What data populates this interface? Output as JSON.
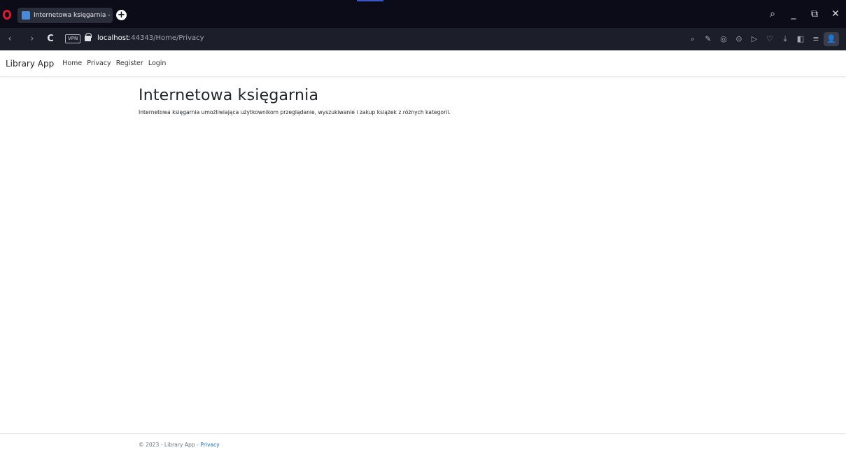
{
  "browser": {
    "tab_title": "Internetowa księgarnia - L",
    "new_tab_symbol": "+",
    "url_host": "localhost",
    "url_path": ":44343/Home/Privacy",
    "vpn_label": "VPN",
    "nav_icons": {
      "back": "‹",
      "forward": "›",
      "reload": "C"
    },
    "window_controls": {
      "search": "⌕",
      "minimize": "_",
      "restore": "⧉",
      "close": "✕"
    },
    "extension_icons": [
      "⌕",
      "✎",
      "◎",
      "⊙",
      "▷",
      "♡",
      "⤓",
      "◧",
      "≡",
      "👤"
    ]
  },
  "navbar": {
    "brand": "Library App",
    "links": [
      "Home",
      "Privacy",
      "Register",
      "Login"
    ]
  },
  "main": {
    "heading": "Internetowa księgarnia",
    "description": "Internetowa księgarnia umożliwiająca użytkownikom przeglądanie, wyszukiwanie i zakup książek z różnych kategorii."
  },
  "footer": {
    "text": "© 2023 - Library App - ",
    "link": "Privacy"
  },
  "colors": {
    "chrome_dark": "#0b0c17",
    "address_bar": "#1c1e29",
    "opera_red": "#e0182d",
    "link_blue": "#1b6ec2"
  }
}
